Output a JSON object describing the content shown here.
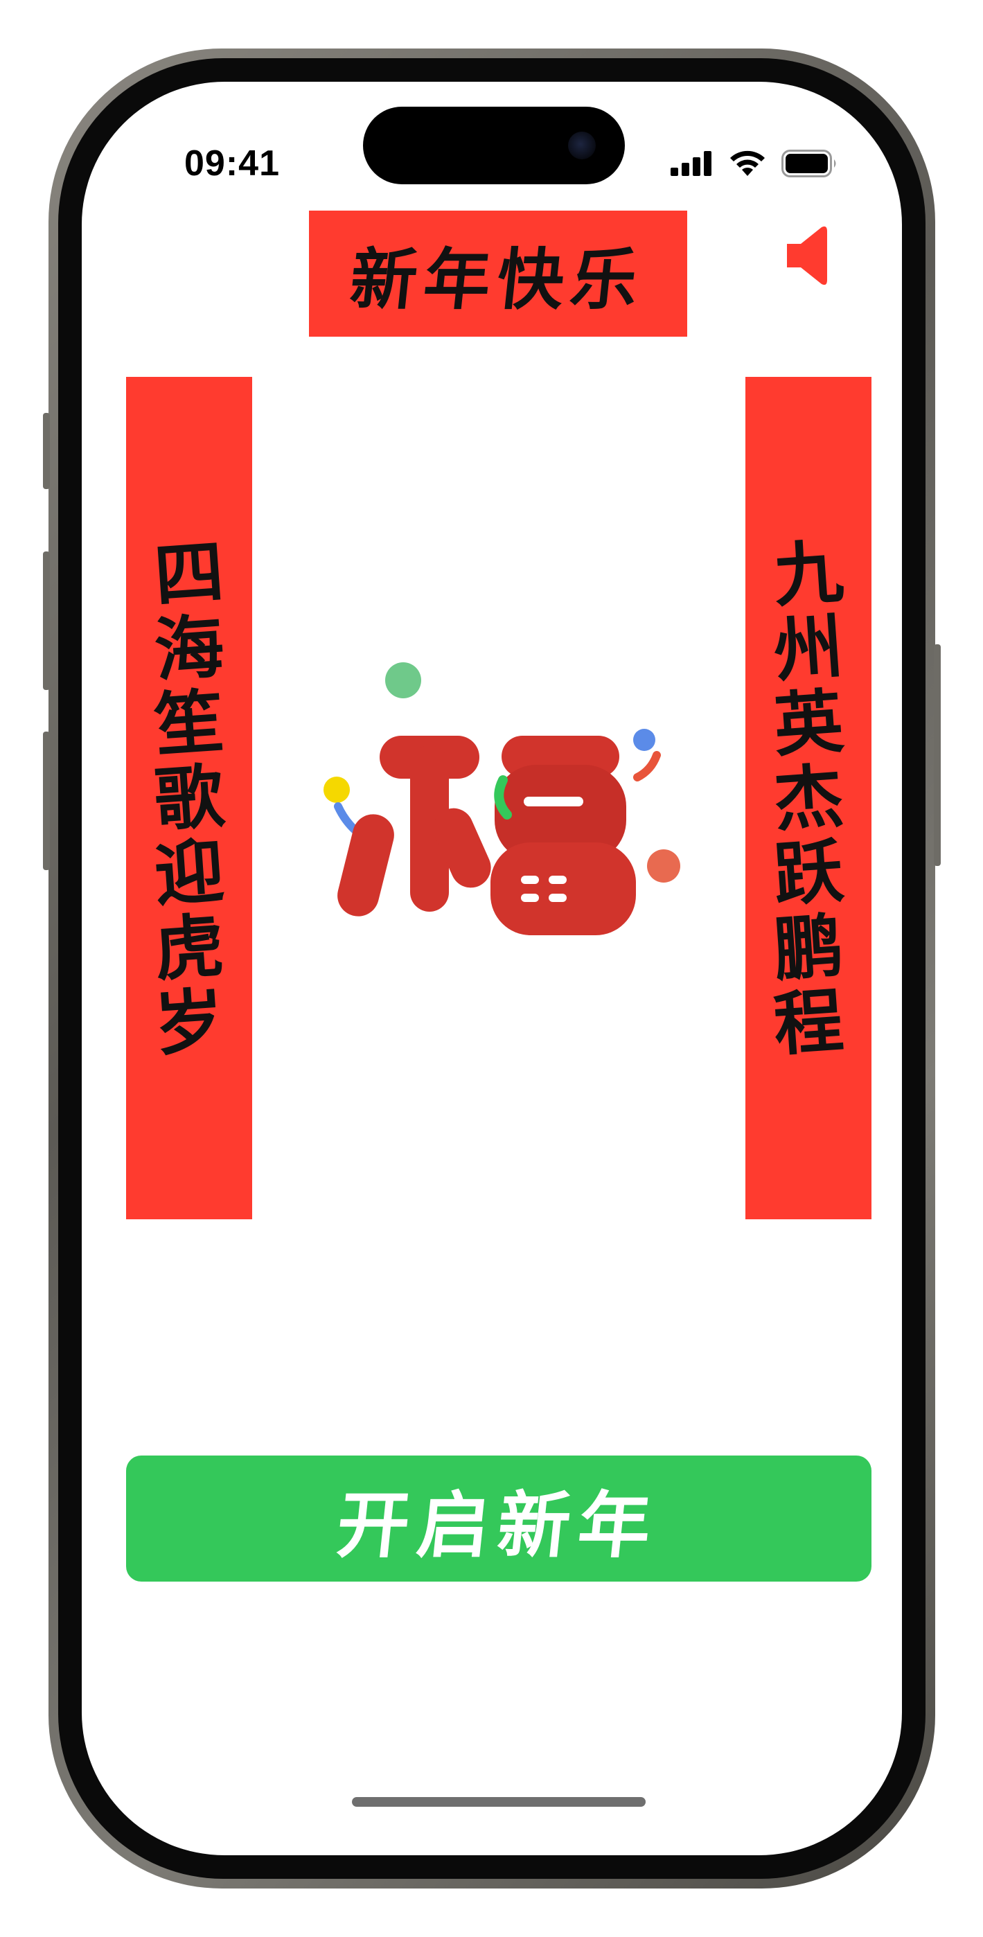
{
  "status_bar": {
    "time": "09:41",
    "icons": [
      "cellular-signal-icon",
      "wifi-icon",
      "battery-icon"
    ]
  },
  "header": {
    "title": "新年快乐",
    "sound_icon": "speaker-icon"
  },
  "couplets": {
    "left": [
      "四",
      "海",
      "笙",
      "歌",
      "迎",
      "虎",
      "岁"
    ],
    "right": [
      "九",
      "州",
      "英",
      "杰",
      "跃",
      "鹏",
      "程"
    ]
  },
  "center_emblem": {
    "name": "fu-character-icon"
  },
  "action": {
    "start_label": "开启新年"
  },
  "colors": {
    "banner_red": "#ff3b2f",
    "fu_red": "#d1342c",
    "button_green": "#34c85a",
    "text_black": "#111111",
    "button_text": "#ffffff"
  }
}
